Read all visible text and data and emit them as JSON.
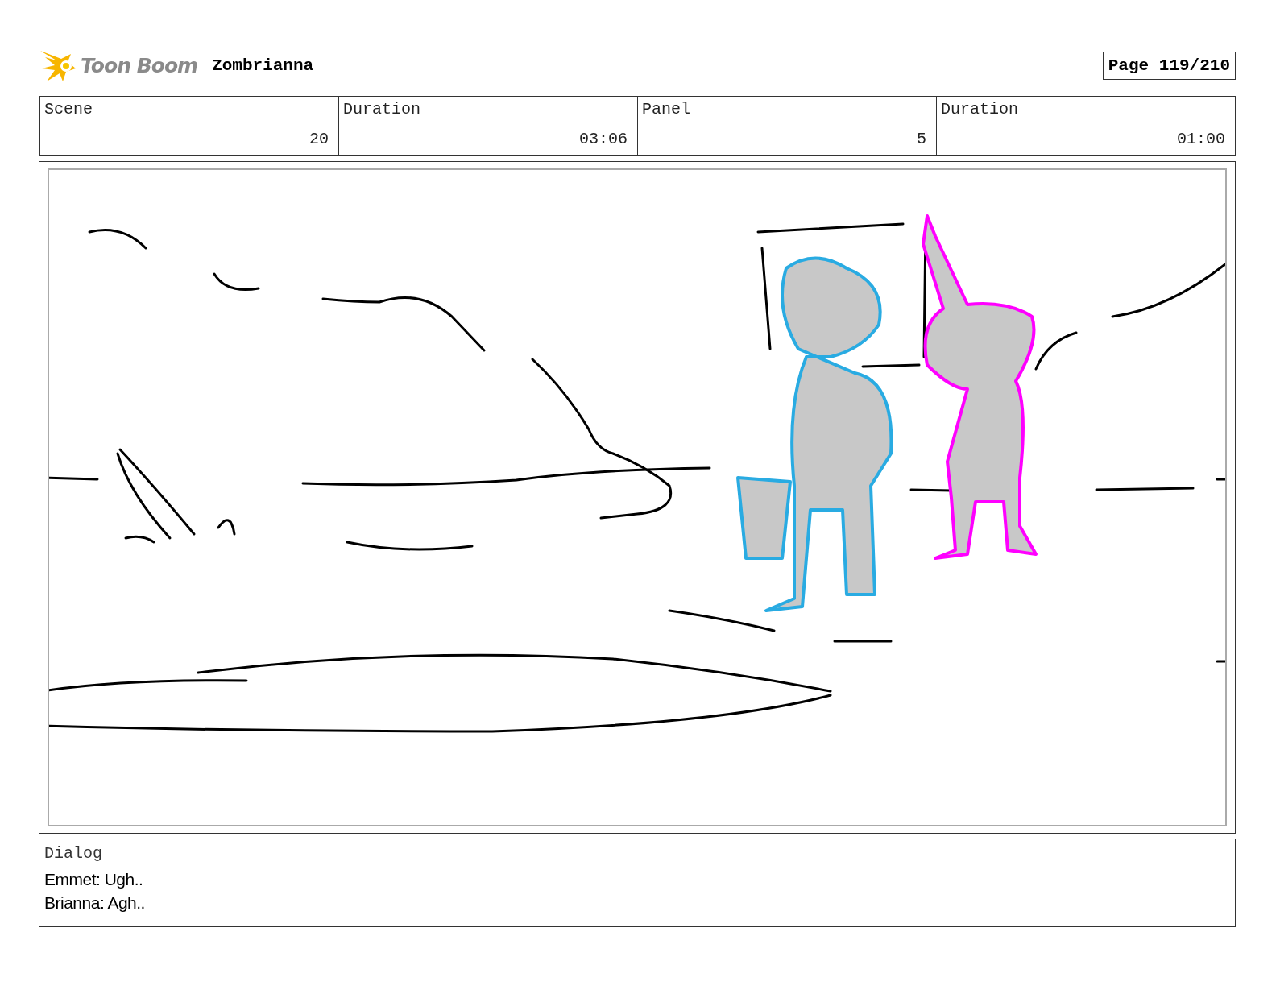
{
  "header": {
    "logo_text": "Toon Boom",
    "project": "Zombrianna",
    "page": "Page 119/210"
  },
  "fields": [
    {
      "label": "Scene",
      "value": "20"
    },
    {
      "label": "Duration",
      "value": "03:06"
    },
    {
      "label": "Panel",
      "value": "5"
    },
    {
      "label": "Duration",
      "value": "01:00"
    }
  ],
  "dialog": {
    "label": "Dialog",
    "lines": [
      "Emmet: Ugh..",
      "Brianna: Agh.."
    ]
  }
}
